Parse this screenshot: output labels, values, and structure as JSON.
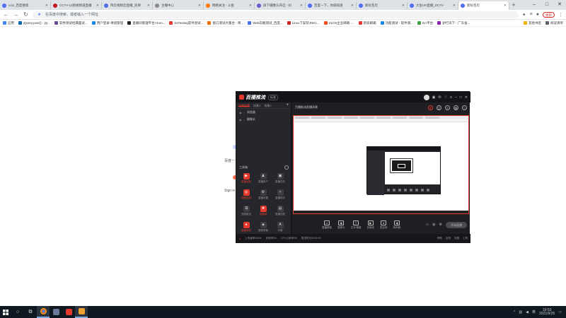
{
  "browser": {
    "tabs": [
      {
        "label": "cctv_百度搜索",
        "color": "#4e6ef2",
        "active": false
      },
      {
        "label": "CCTV-13新闻频道直播",
        "color": "#c4161c",
        "active": false
      },
      {
        "label": "阵云视频云直播_双目",
        "color": "#4a6ee0",
        "active": false
      },
      {
        "label": "主播中心",
        "color": "#888888",
        "active": false
      },
      {
        "label": "网络关注 - 斗鱼",
        "color": "#ff7a00",
        "active": false
      },
      {
        "label": "屏下摄像头开启 - 抖",
        "color": "#6a5acd",
        "active": false
      },
      {
        "label": "百度一下，你就知道",
        "color": "#4e6ef2",
        "active": false
      },
      {
        "label": "新标签页",
        "color": "#4e6ef2",
        "active": false
      },
      {
        "label": "大鱼VR直播_DCTV",
        "color": "#4e6ef2",
        "active": false
      },
      {
        "label": "新标签页",
        "color": "#4e6ef2",
        "active": true
      }
    ],
    "address_placeholder": "在百度中搜索，或者输入一个网址",
    "update_label": "更新",
    "bookmarks": [
      {
        "label": "应用",
        "color": "#4285f4"
      },
      {
        "label": "jQuery.post() - jQ...",
        "color": "#0769ad"
      },
      {
        "label": "软件测试经典面试...",
        "color": "#6a4c93"
      },
      {
        "label": "用户登录-禅道管理",
        "color": "#1e88e5"
      },
      {
        "label": "直播间管理平台-Hom...",
        "color": "#222222"
      },
      {
        "label": "51Testing软件测试...",
        "color": "#e53935"
      },
      {
        "label": "接口测试大集合 - 简...",
        "color": "#ef6c00"
      },
      {
        "label": "Web前端测试_百度...",
        "color": "#4e6ef2"
      },
      {
        "label": "Linux下安装JDK1...",
        "color": "#c62828"
      },
      {
        "label": "21CN企业邮箱 -...",
        "color": "#f4511e"
      },
      {
        "label": "新浪邮箱",
        "color": "#e53935"
      },
      {
        "label": "功能测试 - 软件测...",
        "color": "#1e88e5"
      },
      {
        "label": "DA平台",
        "color": "#43a047"
      },
      {
        "label": "驴行天下 - 广东省...",
        "color": "#8e24aa"
      }
    ],
    "other_bookmarks": "其他书签",
    "reading_list": "阅读清单"
  },
  "page_fragments": {
    "left_1": "百度一",
    "left_2": "Sign in"
  },
  "app": {
    "name": "百播推流",
    "version": "标准",
    "scene_tabs": [
      "场景配置",
      "场景1",
      "场景2"
    ],
    "sources": [
      "浏览器",
      "摄像头"
    ],
    "tools_header": "工具箱",
    "tools": [
      {
        "label": "直播回放",
        "red": true
      },
      {
        "label": "直播用户",
        "red": false
      },
      {
        "label": "直播任务",
        "red": false
      },
      {
        "label": "视频监测",
        "red": true
      },
      {
        "label": "直播设置",
        "red": false
      },
      {
        "label": "直播助手",
        "red": false
      },
      {
        "label": "多路推流",
        "red": false
      },
      {
        "label": "直播间",
        "red": true
      },
      {
        "label": "直播回放",
        "red": false
      },
      {
        "label": "直播录制",
        "red": true
      },
      {
        "label": "虚拟背景",
        "red": false
      },
      {
        "label": "字幕",
        "red": false
      }
    ],
    "stage_title": "百播推流直播场景",
    "controls": [
      {
        "label": "直播屏幕",
        "icon": "▭"
      },
      {
        "label": "摄像头",
        "icon": "◉"
      },
      {
        "label": "文字/弹幕",
        "icon": "T"
      },
      {
        "label": "多媒体",
        "icon": "▶"
      },
      {
        "label": "麦克风",
        "icon": "●"
      },
      {
        "label": "扬声器",
        "icon": "◀"
      }
    ],
    "start_label": "开始直播",
    "status": [
      "上传速率0KB/s",
      "丢帧率0%",
      "CPU占用率0%",
      "推流时长00:00:00"
    ],
    "status_right": [
      "帮助",
      "反馈",
      "设置",
      "工具"
    ]
  },
  "taskbar": {
    "time": "19:53",
    "date": "2021/9/25"
  }
}
